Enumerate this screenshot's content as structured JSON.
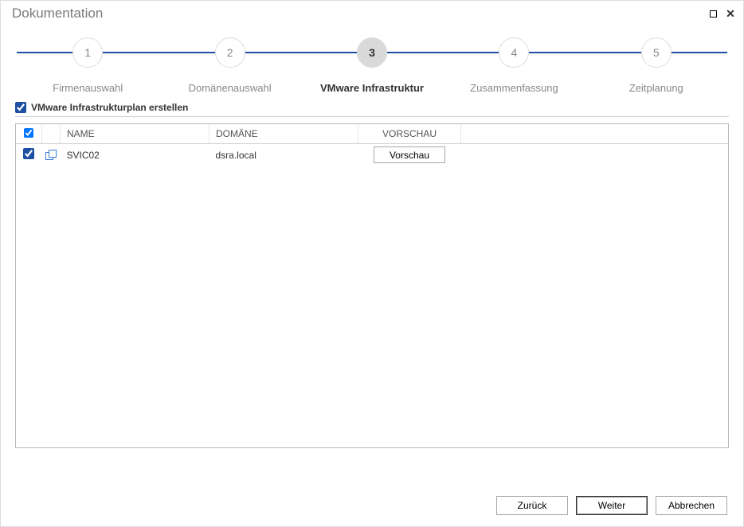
{
  "window": {
    "title": "Dokumentation"
  },
  "steps": [
    {
      "num": "1",
      "label": "Firmenauswahl"
    },
    {
      "num": "2",
      "label": "Domänenauswahl"
    },
    {
      "num": "3",
      "label": "VMware Infrastruktur"
    },
    {
      "num": "4",
      "label": "Zusammenfassung"
    },
    {
      "num": "5",
      "label": "Zeitplanung"
    }
  ],
  "create_plan": {
    "label": "VMware Infrastrukturplan erstellen",
    "checked": true
  },
  "table": {
    "headers": {
      "name": "NAME",
      "domain": "DOMÄNE",
      "preview": "VORSCHAU"
    },
    "rows": [
      {
        "checked": true,
        "name": "SVIC02",
        "domain": "dsra.local",
        "preview": "Vorschau"
      }
    ]
  },
  "buttons": {
    "back": "Zurück",
    "next": "Weiter",
    "cancel": "Abbrechen"
  }
}
